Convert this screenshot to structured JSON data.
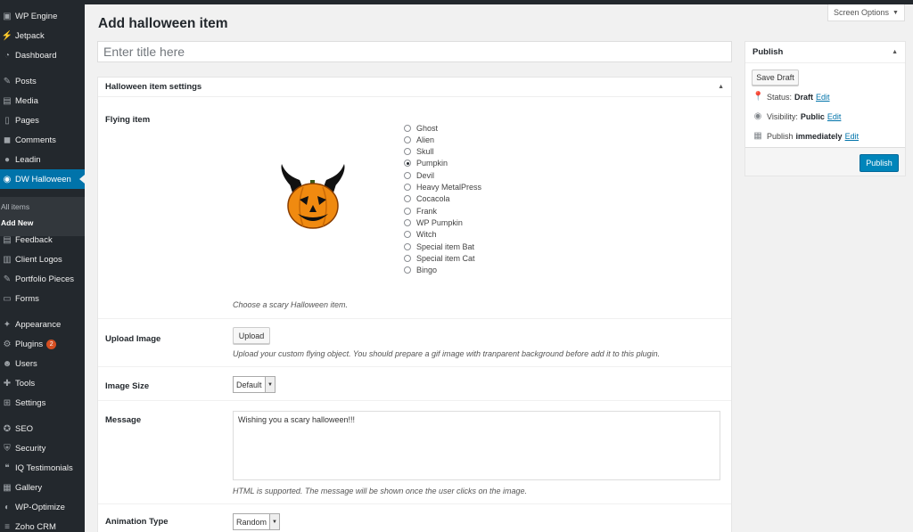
{
  "sidebar": {
    "items": [
      {
        "label": "WP Engine",
        "icon": "wp-engine-icon"
      },
      {
        "label": "Jetpack",
        "icon": "jetpack-icon"
      },
      {
        "label": "Dashboard",
        "icon": "dashboard-icon"
      },
      {
        "label": "Posts",
        "icon": "pushpin-icon"
      },
      {
        "label": "Media",
        "icon": "media-icon"
      },
      {
        "label": "Pages",
        "icon": "pages-icon"
      },
      {
        "label": "Comments",
        "icon": "comments-icon"
      },
      {
        "label": "Leadin",
        "icon": "leadin-icon"
      },
      {
        "label": "DW Halloween",
        "icon": "halloween-icon"
      },
      {
        "label": "Feedback",
        "icon": "feedback-icon"
      },
      {
        "label": "Client Logos",
        "icon": "client-logos-icon"
      },
      {
        "label": "Portfolio Pieces",
        "icon": "pushpin-icon"
      },
      {
        "label": "Forms",
        "icon": "forms-icon"
      },
      {
        "label": "Appearance",
        "icon": "appearance-icon"
      },
      {
        "label": "Plugins",
        "icon": "plugins-icon",
        "badge": "2"
      },
      {
        "label": "Users",
        "icon": "users-icon"
      },
      {
        "label": "Tools",
        "icon": "tools-icon"
      },
      {
        "label": "Settings",
        "icon": "settings-icon"
      },
      {
        "label": "SEO",
        "icon": "seo-icon"
      },
      {
        "label": "Security",
        "icon": "security-icon"
      },
      {
        "label": "IQ Testimonials",
        "icon": "testimonials-icon"
      },
      {
        "label": "Gallery",
        "icon": "gallery-icon"
      },
      {
        "label": "WP-Optimize",
        "icon": "wp-optimize-icon"
      },
      {
        "label": "Zoho CRM",
        "icon": "zoho-icon"
      }
    ],
    "submenu": {
      "all_items": "All items",
      "add_new": "Add New"
    }
  },
  "screen_options": "Screen Options",
  "page_title": "Add halloween item",
  "title_placeholder": "Enter title here",
  "settings": {
    "header": "Halloween item settings",
    "flying_item_label": "Flying item",
    "flying_options": [
      "Ghost",
      "Alien",
      "Skull",
      "Pumpkin",
      "Devil",
      "Heavy MetalPress",
      "Cocacola",
      "Frank",
      "WP Pumpkin",
      "Witch",
      "Special item Bat",
      "Special item Cat",
      "Bingo"
    ],
    "selected_option": "Pumpkin",
    "flying_desc": "Choose a scary Halloween item.",
    "upload_label": "Upload Image",
    "upload_button": "Upload",
    "upload_desc": "Upload your custom flying object. You should prepare a gif image with tranparent background before add it to this plugin.",
    "image_size_label": "Image Size",
    "image_size_value": "Default",
    "message_label": "Message",
    "message_value": "Wishing you a scary halloween!!!",
    "message_desc": "HTML is supported. The message will be shown once the user clicks on the image.",
    "animation_label": "Animation Type",
    "animation_value": "Random"
  },
  "publish": {
    "header": "Publish",
    "save_draft": "Save Draft",
    "status_label": "Status:",
    "status_value": "Draft",
    "visibility_label": "Visibility:",
    "visibility_value": "Public",
    "publish_label": "Publish",
    "publish_value": "immediately",
    "edit_label": "Edit",
    "publish_button": "Publish"
  },
  "colors": {
    "sidebar_bg": "#23282d",
    "active_blue": "#0073aa",
    "publish_blue": "#0085ba",
    "badge_orange": "#d54e21"
  }
}
